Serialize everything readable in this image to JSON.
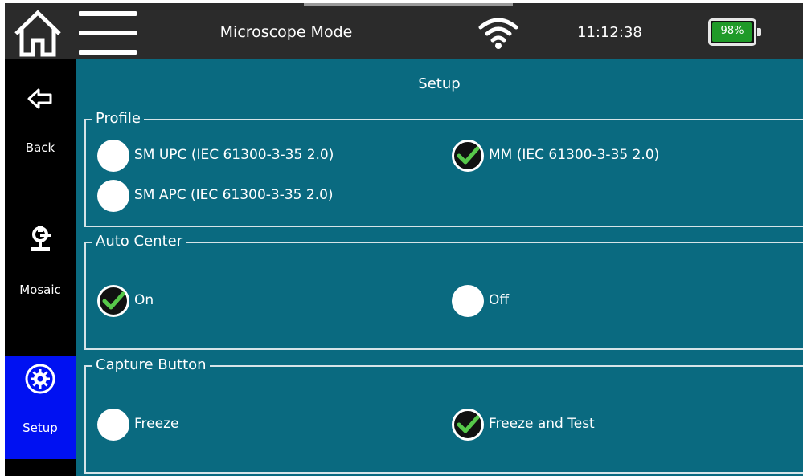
{
  "header": {
    "mode_title": "Microscope Mode",
    "clock": "11:12:38",
    "battery_percent": "98%",
    "battery_level": 0.98,
    "battery_color": "#1f9a28",
    "home_icon": "home-icon",
    "menu_icon": "hamburger-menu-icon",
    "wifi_icon": "wifi-icon"
  },
  "sidebar": {
    "active_color": "#0011f2",
    "items": [
      {
        "label": "Back",
        "icon": "back-arrow-icon",
        "active": false
      },
      {
        "label": "Mosaic",
        "icon": "microscope-icon",
        "active": false
      },
      {
        "label": "Setup",
        "icon": "gear-icon",
        "active": true
      }
    ]
  },
  "main": {
    "title": "Setup",
    "background": "#0a6a80",
    "groups": [
      {
        "label": "Profile",
        "options": [
          {
            "label": "SM UPC (IEC 61300-3-35 2.0)",
            "checked": false
          },
          {
            "label": "SM APC (IEC 61300-3-35 2.0)",
            "checked": false
          },
          {
            "label": "MM (IEC 61300-3-35 2.0)",
            "checked": true
          }
        ]
      },
      {
        "label": "Auto Center",
        "options": [
          {
            "label": "On",
            "checked": true
          },
          {
            "label": "Off",
            "checked": false
          }
        ]
      },
      {
        "label": "Capture Button",
        "options": [
          {
            "label": "Freeze",
            "checked": false
          },
          {
            "label": "Freeze and Test",
            "checked": true
          }
        ]
      }
    ]
  }
}
